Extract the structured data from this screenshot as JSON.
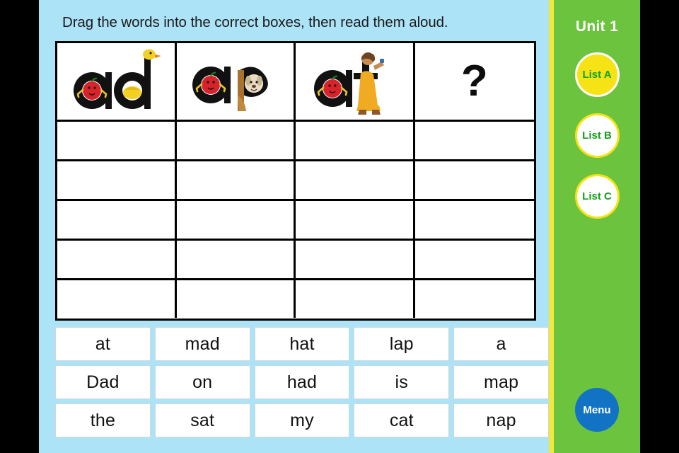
{
  "instruction": "Drag the words into the correct boxes, then read them aloud.",
  "grid": {
    "columns": [
      {
        "label": "ad",
        "art": "apple-duck",
        "letters": [
          "a",
          "d"
        ]
      },
      {
        "label": "ap",
        "art": "apple-puppy",
        "letters": [
          "a",
          "p"
        ]
      },
      {
        "label": "at",
        "art": "apple-teacher",
        "letters": [
          "a",
          "t"
        ]
      },
      {
        "label": "?",
        "art": "question-mark",
        "letters": [
          "?"
        ]
      }
    ],
    "drop_rows": 5
  },
  "word_bank": {
    "rows": [
      [
        "at",
        "mad",
        "hat",
        "lap",
        "a"
      ],
      [
        "Dad",
        "on",
        "had",
        "is",
        "map"
      ],
      [
        "the",
        "sat",
        "my",
        "cat",
        "nap"
      ]
    ]
  },
  "sidebar": {
    "unit": "Unit 1",
    "lists": [
      {
        "label": "List A",
        "active": true
      },
      {
        "label": "List B",
        "active": false
      },
      {
        "label": "List C",
        "active": false
      }
    ],
    "menu": "Menu"
  },
  "colors": {
    "panel_blue": "#ade3f7",
    "sidebar_green": "#6cc33e",
    "stripe_yellow": "#f2e83c",
    "list_active_yellow": "#f5e316",
    "list_text_green": "#15a01a",
    "menu_blue": "#1272c4",
    "letterbox_black": "#000000"
  }
}
